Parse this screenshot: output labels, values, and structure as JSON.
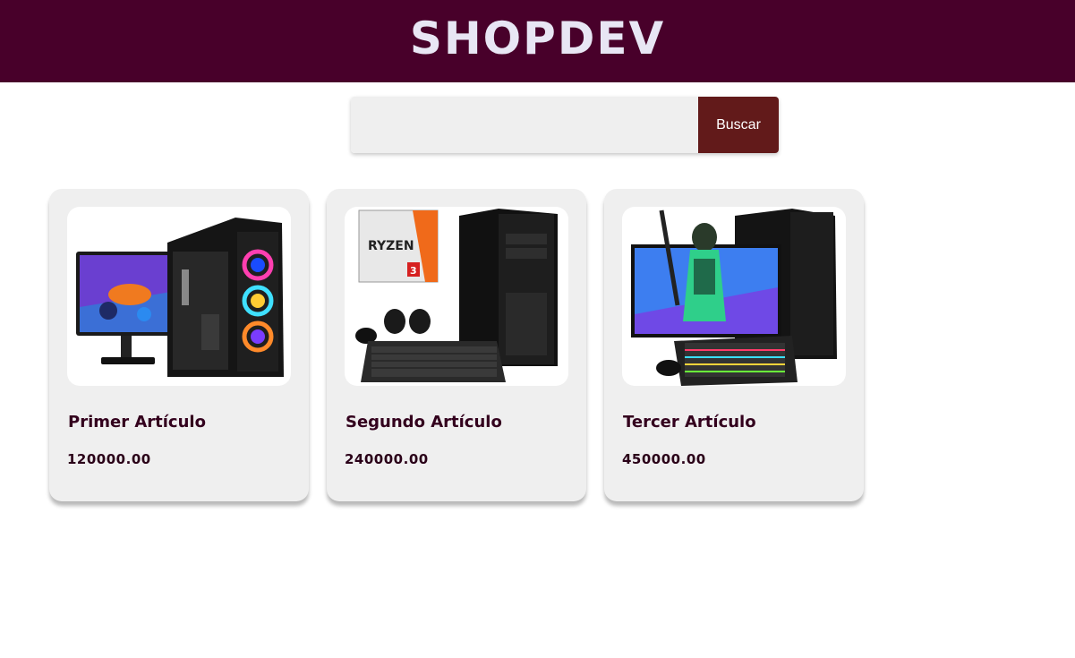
{
  "header": {
    "brand": "SHOPDEV"
  },
  "search": {
    "placeholder": "",
    "value": "",
    "button_label": "Buscar"
  },
  "products": [
    {
      "title": "Primer Artículo",
      "price": "120000.00",
      "image": "gaming-pc-bundle-icon"
    },
    {
      "title": "Segundo Artículo",
      "price": "240000.00",
      "image": "ryzen-pc-bundle-icon"
    },
    {
      "title": "Tercer Artículo",
      "price": "450000.00",
      "image": "gaming-setup-icon"
    }
  ],
  "colors": {
    "header_bg": "#48002a",
    "brand_text": "#e8e6f4",
    "button_bg": "#621a1a",
    "card_bg": "#efefef",
    "title_text": "#33001d"
  }
}
